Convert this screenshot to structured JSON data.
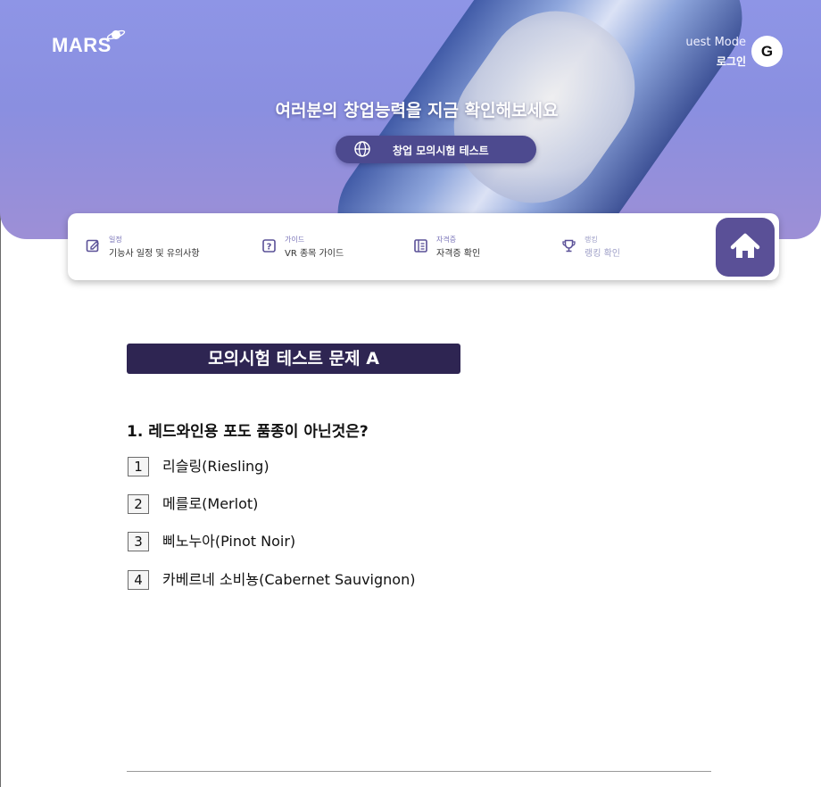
{
  "header": {
    "logo": "MARS",
    "guest_mode": "uest Mode",
    "login": "로그인",
    "avatar_letter": "G",
    "headline": "여러분의 창업능력을 지금 확인해보세요",
    "cta_label": "창업 모의시험 테스트"
  },
  "nav": {
    "items": [
      {
        "small": "일정",
        "main": "기능사 일정 및 유의사항",
        "icon": "edit-icon"
      },
      {
        "small": "가이드",
        "main": "VR 종목 가이드",
        "icon": "help-icon"
      },
      {
        "small": "자격증",
        "main": "자격증 확인",
        "icon": "certificate-icon"
      },
      {
        "small": "랭킹",
        "main": "랭킹 확인",
        "icon": "trophy-icon"
      }
    ],
    "home_icon": "home-icon"
  },
  "quiz": {
    "title": "모의시험 테스트 문제 A",
    "question": "1. 레드와인용 포도 품종이 아닌것은?",
    "options": [
      {
        "num": "1",
        "label": "리슬링(Riesling)"
      },
      {
        "num": "2",
        "label": "메를로(Merlot)"
      },
      {
        "num": "3",
        "label": "삐노누아(Pinot Noir)"
      },
      {
        "num": "4",
        "label": "카베르네 소비뇽(Cabernet Sauvignon)"
      }
    ]
  },
  "colors": {
    "hero_gradient_top": "#8e95e6",
    "cta_bg": "#4d4a8f",
    "home_bg": "#5a5097",
    "title_bg": "#2e2552",
    "accent": "#7a74b8"
  }
}
